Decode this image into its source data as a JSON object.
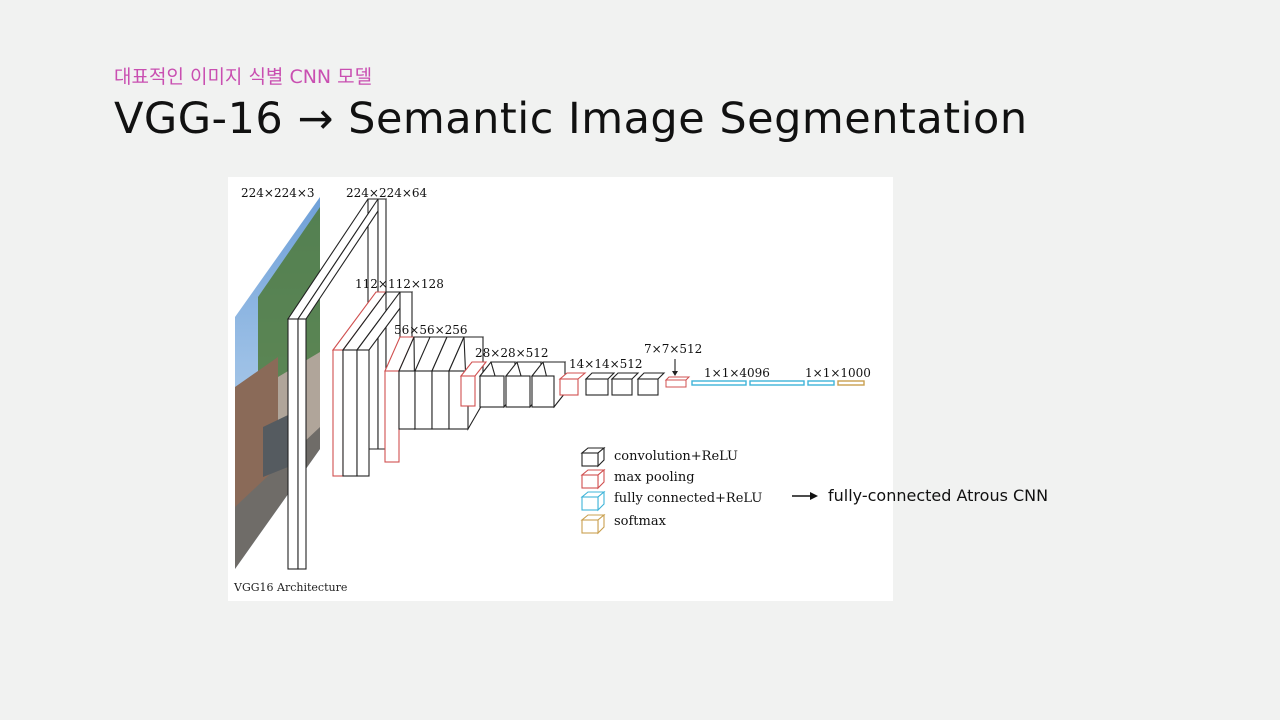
{
  "slide": {
    "subtitle": "대표적인 이미지 식별 CNN 모델",
    "title": "VGG-16 → Semantic Image Segmentation"
  },
  "figure": {
    "caption": "VGG16 Architecture",
    "dims": {
      "input": "224×224×3",
      "conv1": "224×224×64",
      "conv2": "112×112×128",
      "conv3": "56×56×256",
      "conv4": "28×28×512",
      "conv5": "14×14×512",
      "pool5": "7×7×512",
      "fc": "1×1×4096",
      "out": "1×1×1000"
    },
    "legend": [
      {
        "label": "convolution+ReLU",
        "color": "#222222"
      },
      {
        "label": "max pooling",
        "color": "#d05050"
      },
      {
        "label": "fully connected+ReLU",
        "color": "#3fb4d8"
      },
      {
        "label": "softmax",
        "color": "#c9a050"
      }
    ]
  },
  "annotation": {
    "label": "fully-connected Atrous CNN"
  }
}
